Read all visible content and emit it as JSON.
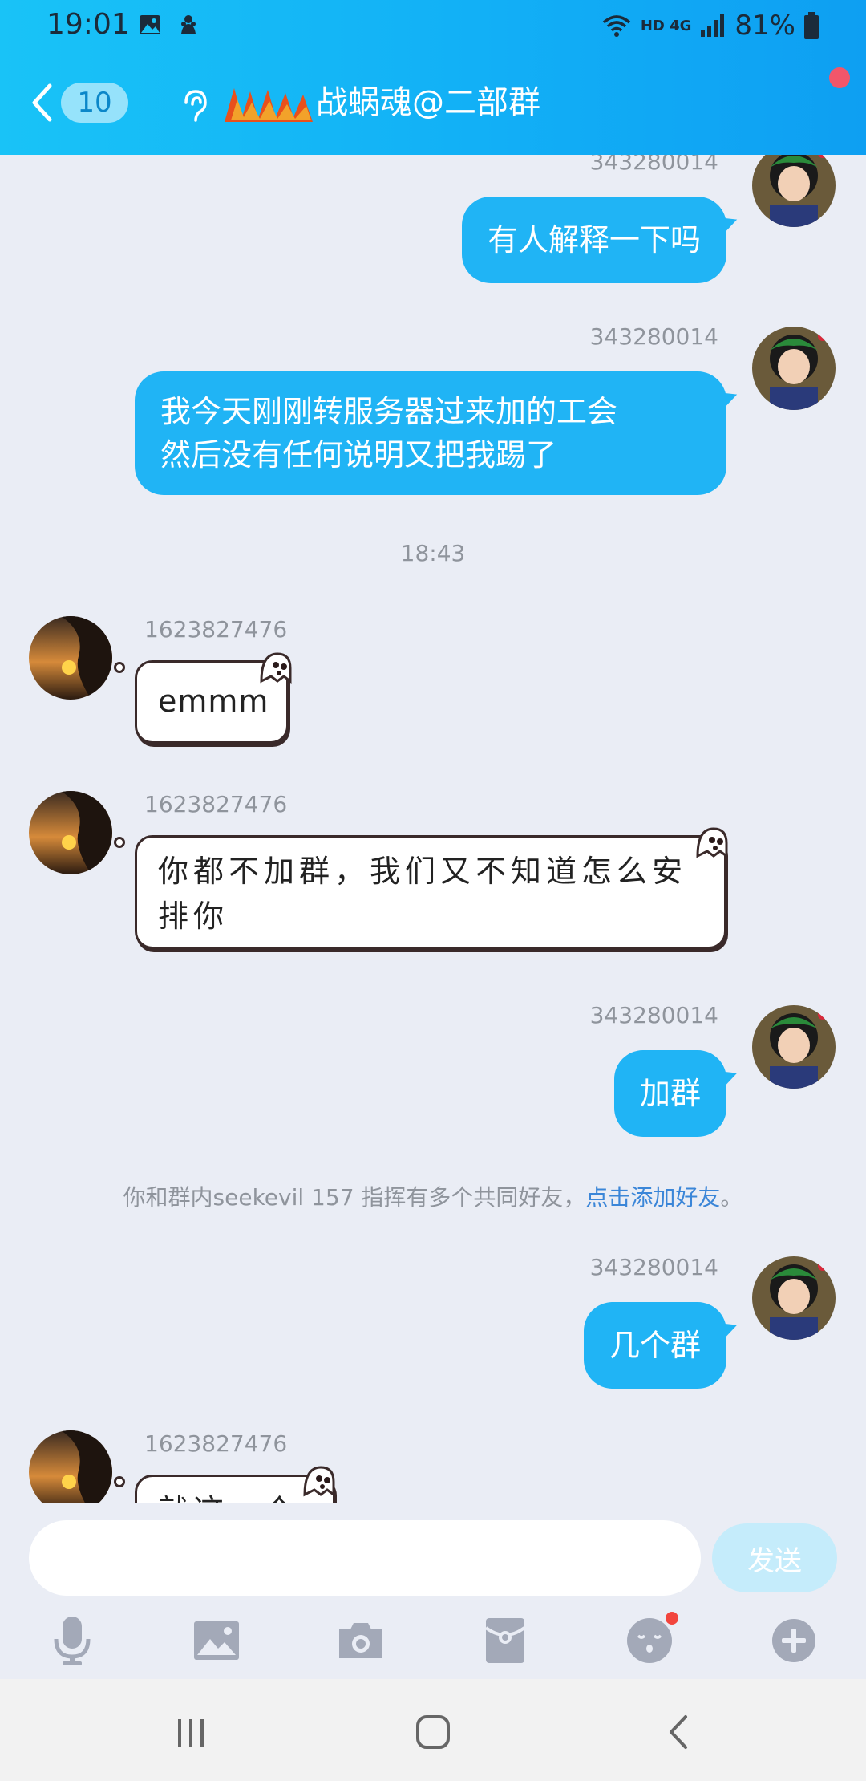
{
  "status_bar": {
    "time": "19:01",
    "network": "HD 4G",
    "battery": "81%"
  },
  "nav": {
    "unread_count": "10",
    "group_title": "战蜗魂@二部群"
  },
  "messages": [
    {
      "sender": "343280014",
      "side": "right",
      "text": "有人解释一下吗"
    },
    {
      "sender": "343280014",
      "side": "right",
      "text_lines": [
        "我今天刚刚转服务器过来加的工会",
        "然后没有任何说明又把我踢了"
      ]
    },
    {
      "sender": "1623827476",
      "side": "left",
      "text": "emmm"
    },
    {
      "sender": "1623827476",
      "side": "left",
      "text_lines": [
        "你都不加群，我们又不知道怎么安",
        "排你"
      ]
    },
    {
      "sender": "343280014",
      "side": "right",
      "text": "加群"
    },
    {
      "sender": "343280014",
      "side": "right",
      "text": "几个群"
    },
    {
      "sender": "1623827476",
      "side": "left",
      "text": "就这一个"
    }
  ],
  "time_separator": "18:43",
  "system_note": {
    "text": "你和群内seekevil 157 指挥有多个共同好友，",
    "link": "点击添加好友",
    "end": "。"
  },
  "input": {
    "value": "",
    "send_label": "发送"
  },
  "toolbar_icons": [
    "microphone-icon",
    "image-icon",
    "camera-icon",
    "red-packet-icon",
    "emoji-icon",
    "plus-icon"
  ],
  "colors": {
    "header_start": "#19c3f7",
    "header_end": "#0e9ff2",
    "bubble_blue": "#20b4f5",
    "chat_bg": "#eaedf5",
    "link": "#3b86d8",
    "badge_red": "#f2566a"
  }
}
